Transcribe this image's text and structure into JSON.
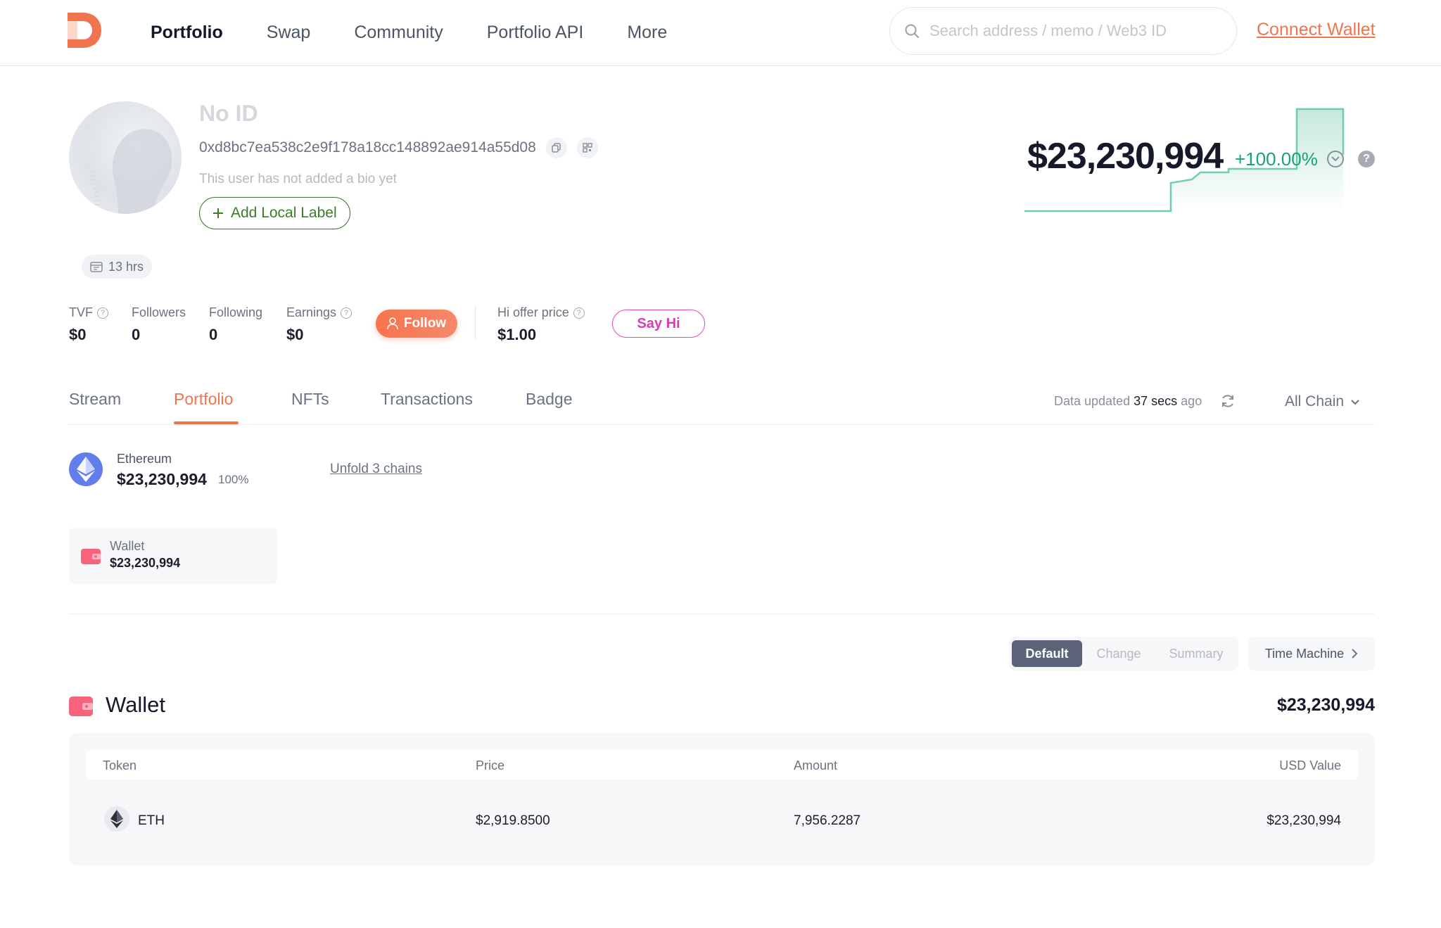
{
  "nav": {
    "items": [
      {
        "label": "Portfolio",
        "active": true
      },
      {
        "label": "Swap",
        "active": false
      },
      {
        "label": "Community",
        "active": false
      },
      {
        "label": "Portfolio API",
        "active": false
      },
      {
        "label": "More",
        "active": false
      }
    ],
    "search_placeholder": "Search address / memo / Web3 ID",
    "connect_label": "Connect Wallet"
  },
  "profile": {
    "name": "No ID",
    "address": "0xd8bc7ea538c2e9f178a18cc148892ae914a55d08",
    "bio": "This user has not added a bio yet",
    "add_label": "Add Local Label",
    "time_chip": "13 hrs"
  },
  "stats": {
    "tvf_label": "TVF",
    "tvf_value": "$0",
    "followers_label": "Followers",
    "followers_value": "0",
    "following_label": "Following",
    "following_value": "0",
    "earnings_label": "Earnings",
    "earnings_value": "$0",
    "follow_label": "Follow",
    "hi_offer_label": "Hi offer price",
    "hi_offer_value": "$1.00",
    "say_hi_label": "Say Hi"
  },
  "networth": {
    "value": "$23,230,994",
    "change": "+100.00%",
    "help": "?"
  },
  "tabs": {
    "items": [
      "Stream",
      "Portfolio",
      "NFTs",
      "Transactions",
      "Badge"
    ],
    "active": "Portfolio",
    "updated_prefix": "Data updated",
    "updated_time": "37 secs",
    "updated_suffix": "ago",
    "chain_selector": "All Chain"
  },
  "chain_summary": {
    "name": "Ethereum",
    "value": "$23,230,994",
    "percent": "100%",
    "unfold": "Unfold 3 chains"
  },
  "wallet_card": {
    "label": "Wallet",
    "value": "$23,230,994"
  },
  "view_toggle": {
    "options": [
      "Default",
      "Change",
      "Summary"
    ],
    "active": "Default",
    "time_machine": "Time Machine"
  },
  "wallet_section": {
    "title": "Wallet",
    "total": "$23,230,994",
    "columns": [
      "Token",
      "Price",
      "Amount",
      "USD Value"
    ],
    "rows": [
      {
        "token": "ETH",
        "price": "$2,919.8500",
        "amount": "7,956.2287",
        "usd_value": "$23,230,994"
      }
    ]
  },
  "colors": {
    "brand": "#f0744e",
    "positive": "#17a377",
    "say_hi": "#e845b7",
    "label_green": "#3d7a2c"
  }
}
